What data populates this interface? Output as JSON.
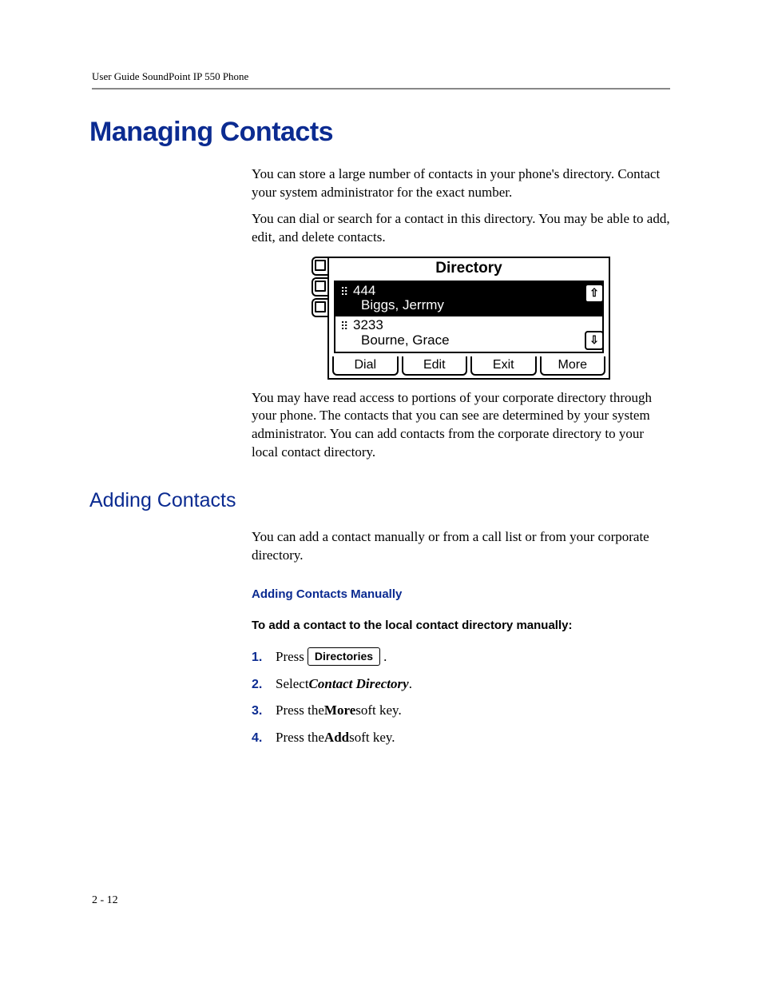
{
  "header": {
    "running": "User Guide SoundPoint IP 550 Phone"
  },
  "section1": {
    "title": "Managing Contacts",
    "para1": "You can store a large number of contacts in your phone's directory. Contact your system administrator for the exact number.",
    "para2": "You can dial or search for a contact in this directory. You may be able to add, edit, and delete contacts.",
    "para3": "You may have read access to portions of your corporate directory through your phone. The contacts that you can see are determined by your system administrator. You can add contacts from the corporate directory to your local contact directory."
  },
  "phone_screen": {
    "title": "Directory",
    "contacts": [
      {
        "number": "444",
        "name": "Biggs, Jerrmy",
        "selected": true
      },
      {
        "number": "3233",
        "name": "Bourne, Grace",
        "selected": false
      }
    ],
    "softkeys": [
      "Dial",
      "Edit",
      "Exit",
      "More"
    ],
    "arrow_up": "⇧",
    "arrow_down": "⇩"
  },
  "section2": {
    "title": "Adding Contacts",
    "para1": "You can add a contact manually or from a call list or from your corporate directory.",
    "sub_heading": "Adding Contacts Manually",
    "instruction_lead": "To add a contact to the local contact directory manually:",
    "steps": {
      "s1_pre": "Press ",
      "s1_button": "Directories",
      "s1_post": " .",
      "s2_pre": "Select ",
      "s2_em": "Contact Directory",
      "s2_post": ".",
      "s3_pre": "Press the ",
      "s3_bold": "More",
      "s3_post": " soft key.",
      "s4_pre": "Press the ",
      "s4_bold": "Add",
      "s4_post": " soft key."
    }
  },
  "page_number": "2 - 12"
}
